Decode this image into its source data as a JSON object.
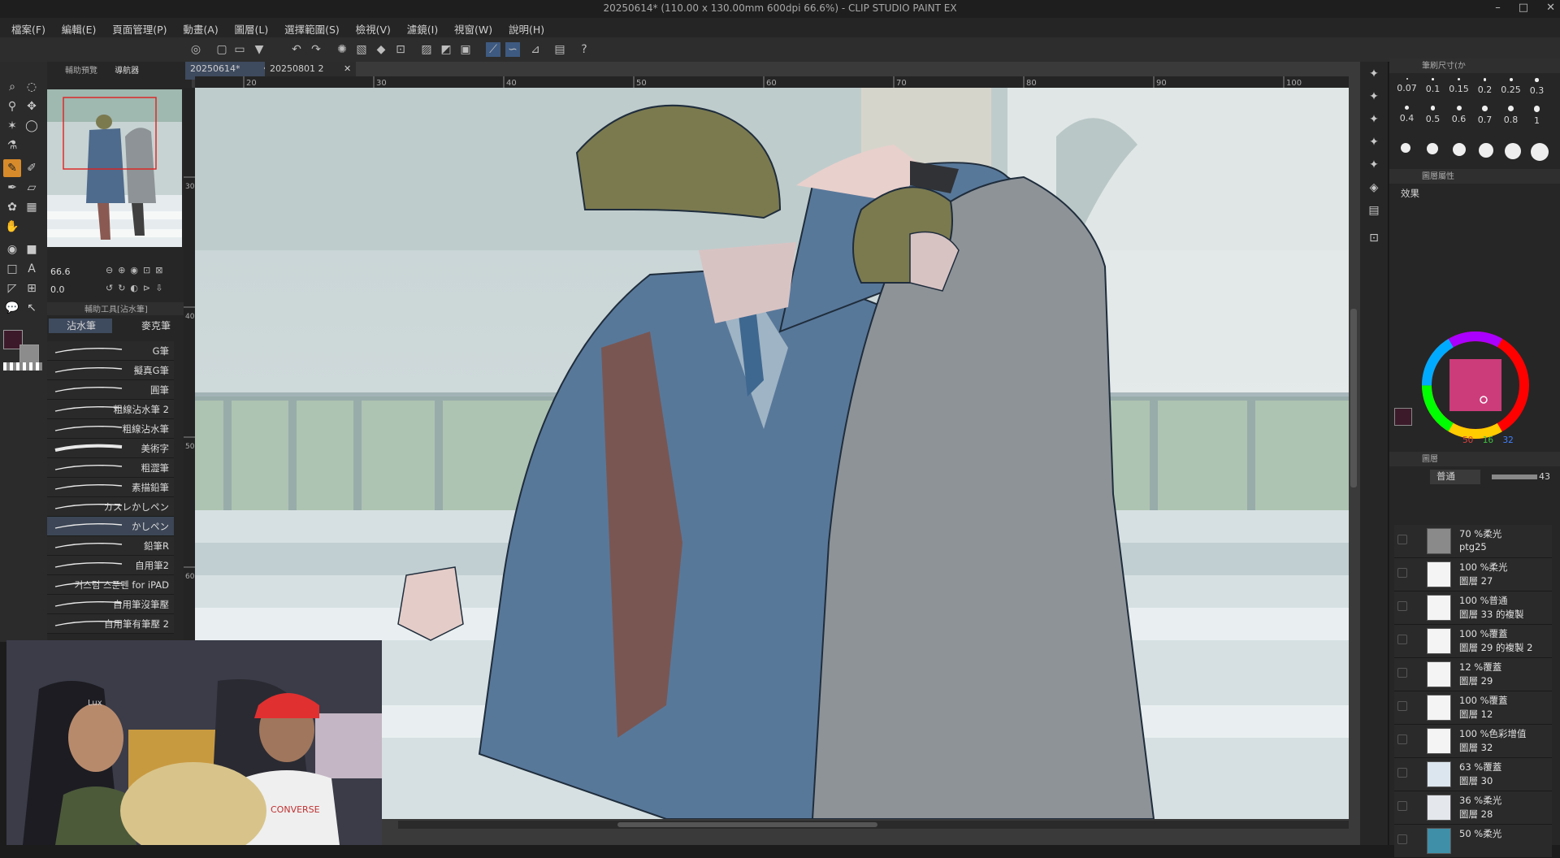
{
  "window": {
    "title": "20250614* (110.00 x 130.00mm 600dpi 66.6%) - CLIP STUDIO PAINT EX",
    "controls": [
      "–",
      "□",
      "✕"
    ]
  },
  "menu": [
    "檔案(F)",
    "編輯(E)",
    "頁面管理(P)",
    "動畫(A)",
    "圖層(L)",
    "選擇範圍(S)",
    "檢視(V)",
    "濾鏡(I)",
    "視窗(W)",
    "說明(H)"
  ],
  "left_panel": {
    "tabs": [
      "輔助預覽",
      "導航器"
    ],
    "zoom_value": "66.6",
    "rotate_value": "0.0",
    "subtool_header": "輔助工具[沾水筆]",
    "subtool_tabs": [
      "沾水筆",
      "麥克筆"
    ],
    "brushes": [
      "G筆",
      "擬真G筆",
      "圓筆",
      "粗線沾水筆 2",
      "粗線沾水筆",
      "美術字",
      "粗澀筆",
      "素描鉛筆",
      "カスレかしペン",
      "かしペン",
      "鉛筆R",
      "自用筆2",
      "커스텀 스푼펜 for iPAD",
      "自用筆沒筆壓",
      "自用筆有筆壓 2"
    ],
    "selected_brush_index": 9
  },
  "documents": {
    "tabs": [
      "20250614*",
      "20250801 2"
    ],
    "active": 0
  },
  "ruler": {
    "h_ticks": [
      "20",
      "30",
      "40",
      "50",
      "60",
      "70",
      "80",
      "90",
      "100"
    ],
    "v_ticks": [
      "30",
      "40",
      "50",
      "60"
    ]
  },
  "right_panel": {
    "brush_size_header": "筆刷尺寸(か",
    "brush_sizes": [
      "0.07",
      "0.1",
      "0.15",
      "0.2",
      "0.25",
      "0.3",
      "0.4",
      "0.5",
      "0.6",
      "0.7",
      "0.8",
      "1"
    ],
    "tool_property_header": "圖層屬性",
    "effect_label": "效果",
    "color_values": [
      "50",
      "16",
      "32"
    ],
    "layer_tabs": [
      "圖層",
      "",
      ""
    ],
    "blend_mode": "普通",
    "opacity": "43",
    "layers": [
      {
        "line1": "70 %柔光",
        "line2": "ptg25",
        "thumb": "#8a8a8a"
      },
      {
        "line1": "100 %柔光",
        "line2": "圖層 27",
        "thumb": "#f4f4f4"
      },
      {
        "line1": "100 %普通",
        "line2": "圖層 33 的複製",
        "thumb": "#f4f4f4"
      },
      {
        "line1": "100 %覆蓋",
        "line2": "圖層 29 的複製 2",
        "thumb": "#f4f4f4"
      },
      {
        "line1": "12 %覆蓋",
        "line2": "圖層 29",
        "thumb": "#f4f4f4"
      },
      {
        "line1": "100 %覆蓋",
        "line2": "圖層 12",
        "thumb": "#f4f4f4"
      },
      {
        "line1": "100 %色彩增值",
        "line2": "圖層 32",
        "thumb": "#f4f4f4"
      },
      {
        "line1": "63 %覆蓋",
        "line2": "圖層 30",
        "thumb": "#dce6ee"
      },
      {
        "line1": "36 %柔光",
        "line2": "圖層 28",
        "thumb": "#e4e8ec"
      },
      {
        "line1": "50 %柔光",
        "line2": "",
        "thumb": "#3f8fa8"
      }
    ]
  },
  "webcam": {
    "chair_text": "Lux",
    "shirt_text": "CONVERSE"
  },
  "colors": {
    "accent": "#d88b2a",
    "main_color": "#3d1a2a",
    "sub_color": "#8c8c8c"
  }
}
